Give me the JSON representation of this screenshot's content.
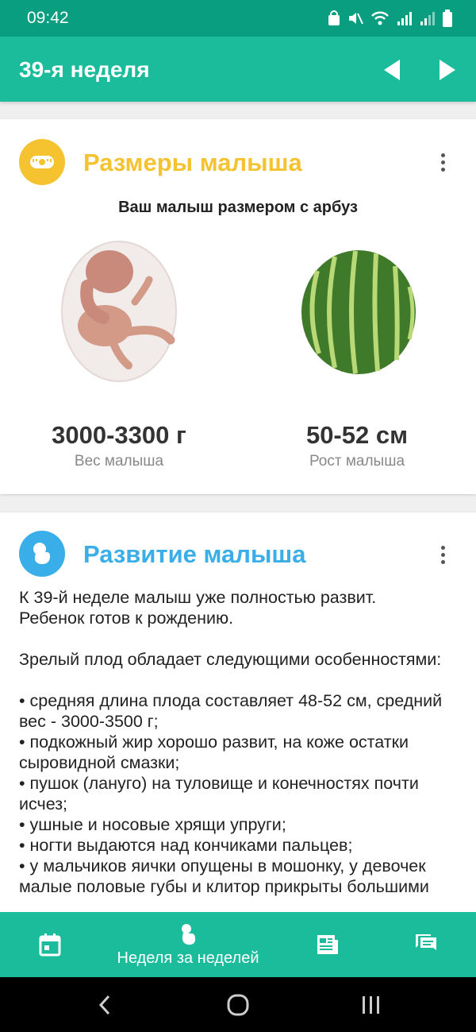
{
  "status_bar": {
    "time": "09:42"
  },
  "app_bar": {
    "title": "39-я неделя"
  },
  "size_card": {
    "title": "Размеры малыша",
    "subtitle": "Ваш малыш размером с арбуз",
    "weight_value": "3000-3300 г",
    "weight_label": "Вес малыша",
    "height_value": "50-52 см",
    "height_label": "Рост малыша"
  },
  "development_card": {
    "title": "Развитие малыша",
    "text": "К 39-й неделе малыш уже полностью развит.\nРебенок готов к рождению.\n\nЗрелый плод обладает следующими особенностями:\n\n• средняя длина плода составляет 48-52 см, средний вес - 3000-3500 г;\n• подкожный жир хорошо развит, на коже остатки сыровидной смазки;\n• пушок (лануго) на туловище и конечностях почти исчез;\n• ушные и носовые хрящи упруги;\n• ногти выдаются над кончиками пальцев;\n• у мальчиков яички опущены в мошонку, у девочек малые половые губы и клитор прикрыты большими"
  },
  "bottom_nav": {
    "active_label": "Неделя за неделей"
  },
  "colors": {
    "primary": "#1abc9c",
    "status": "#0a9e80",
    "size_accent": "#f5c330",
    "dev_accent": "#3aaee8"
  },
  "icons": [
    "calendar-icon",
    "baby-icon",
    "article-icon",
    "chat-icon"
  ]
}
